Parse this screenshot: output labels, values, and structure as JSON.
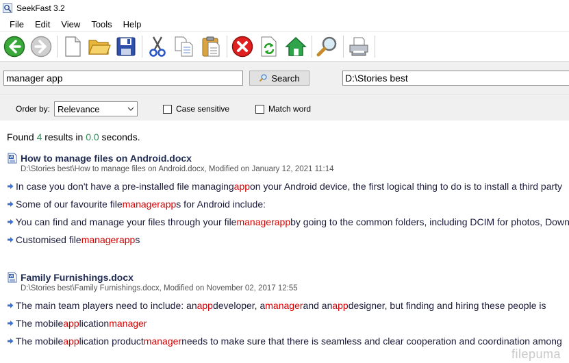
{
  "window": {
    "title": "SeekFast 3.2"
  },
  "menu": [
    "File",
    "Edit",
    "View",
    "Tools",
    "Help"
  ],
  "toolbar": {
    "icons": [
      "back-arrow-icon",
      "forward-arrow-icon",
      "new-document-icon",
      "open-folder-icon",
      "save-icon",
      "cut-icon",
      "copy-icon",
      "paste-icon",
      "stop-icon",
      "refresh-icon",
      "home-icon",
      "magnifier-icon",
      "print-icon"
    ]
  },
  "search": {
    "query": "manager app",
    "button_label": "Search",
    "folder": "D:\\Stories best"
  },
  "options": {
    "order_label": "Order by:",
    "order_value": "Relevance",
    "case_sensitive_label": "Case sensitive",
    "match_word_label": "Match word"
  },
  "summary": {
    "prefix": "Found ",
    "count": "4",
    "middle": " results in ",
    "seconds": "0.0",
    "suffix": " seconds."
  },
  "results": [
    {
      "title": "How to manage files on Android.docx",
      "meta": "D:\\Stories best\\How to manage files on Android.docx, Modified on January 12, 2021 11:14",
      "snippets": [
        [
          {
            "t": "In case you don't have a pre-installed file managing "
          },
          {
            "t": "app",
            "h": true
          },
          {
            "t": " on your Android device, the first logical thing to do is to install a third party"
          }
        ],
        [
          {
            "t": "Some of our favourite file "
          },
          {
            "t": "manager",
            "h": true
          },
          {
            "t": " "
          },
          {
            "t": "app",
            "h": true
          },
          {
            "t": "s for Android include:"
          }
        ],
        [
          {
            "t": "You can find and manage your files through your file "
          },
          {
            "t": "manager",
            "h": true
          },
          {
            "t": " "
          },
          {
            "t": "app",
            "h": true
          },
          {
            "t": " by going to the common folders, including DCIM for photos, Downloads"
          }
        ],
        [
          {
            "t": "Customised file "
          },
          {
            "t": "manager",
            "h": true
          },
          {
            "t": " "
          },
          {
            "t": "app",
            "h": true
          },
          {
            "t": "s"
          }
        ]
      ]
    },
    {
      "title": "Family Furnishings.docx",
      "meta": "D:\\Stories best\\Family Furnishings.docx, Modified on November 02, 2017 12:55",
      "snippets": [
        [
          {
            "t": "The main team players need to include: an "
          },
          {
            "t": "app",
            "h": true
          },
          {
            "t": " developer, a "
          },
          {
            "t": "manager",
            "h": true
          },
          {
            "t": " and an "
          },
          {
            "t": "app",
            "h": true
          },
          {
            "t": " designer, but finding and hiring these people is"
          }
        ],
        [
          {
            "t": "The mobile "
          },
          {
            "t": "app",
            "h": true
          },
          {
            "t": "lication "
          },
          {
            "t": "manager",
            "h": true
          }
        ],
        [
          {
            "t": "The mobile "
          },
          {
            "t": "app",
            "h": true
          },
          {
            "t": "lication product "
          },
          {
            "t": "manager",
            "h": true
          },
          {
            "t": " needs to make sure that there is seamless and clear cooperation and coordination among"
          }
        ]
      ]
    }
  ],
  "watermark": "filepuma"
}
